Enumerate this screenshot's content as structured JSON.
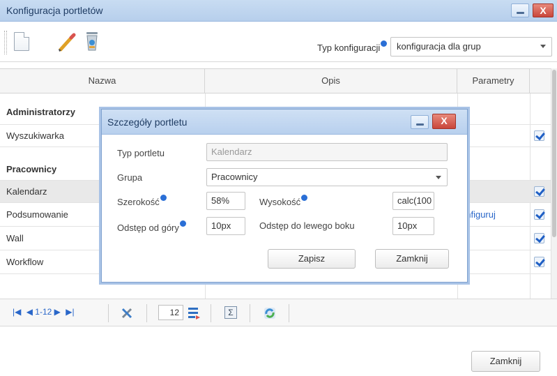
{
  "window": {
    "title": "Konfiguracja portletów",
    "close_glyph": "X"
  },
  "toolbar": {
    "icons": [
      "new-document-icon",
      "edit-pencil-icon",
      "delete-trash-icon"
    ],
    "config_type_label": "Typ konfiguracji",
    "config_type_value": "konfiguracja dla grup"
  },
  "grid": {
    "columns": [
      "Nazwa",
      "Opis",
      "Parametry"
    ],
    "groups": [
      {
        "name": "Administratorzy",
        "rows": [
          {
            "name": "Wyszukiwarka",
            "param": "",
            "checked": true
          }
        ]
      },
      {
        "name": "Pracownicy",
        "rows": [
          {
            "name": "Kalendarz",
            "param": "",
            "checked": true,
            "selected": true
          },
          {
            "name": "Podsumowanie",
            "param": "onfiguruj",
            "checked": true
          },
          {
            "name": "Wall",
            "param": "",
            "checked": true
          },
          {
            "name": "Workflow",
            "param": "",
            "checked": true
          }
        ]
      }
    ]
  },
  "pager": {
    "range": "1-12",
    "page_size": "12"
  },
  "footer": {
    "close_label": "Zamknij"
  },
  "dialog": {
    "title": "Szczegóły portletu",
    "close_glyph": "X",
    "portlet_type_label": "Typ portletu",
    "portlet_type_value": "Kalendarz",
    "group_label": "Grupa",
    "group_value": "Pracownicy",
    "width_label": "Szerokość",
    "width_value": "58%",
    "height_label": "Wysokość",
    "height_value": "calc(100",
    "top_offset_label": "Odstęp od góry",
    "top_offset_value": "10px",
    "left_offset_label": "Odstęp do lewego boku",
    "left_offset_value": "10px",
    "save_label": "Zapisz",
    "close_label": "Zamknij"
  },
  "colors": {
    "title_bar": "#c8dcf2",
    "close_red": "#c9463a",
    "link_blue": "#2a67c9",
    "check_blue": "#1f5fc5"
  }
}
